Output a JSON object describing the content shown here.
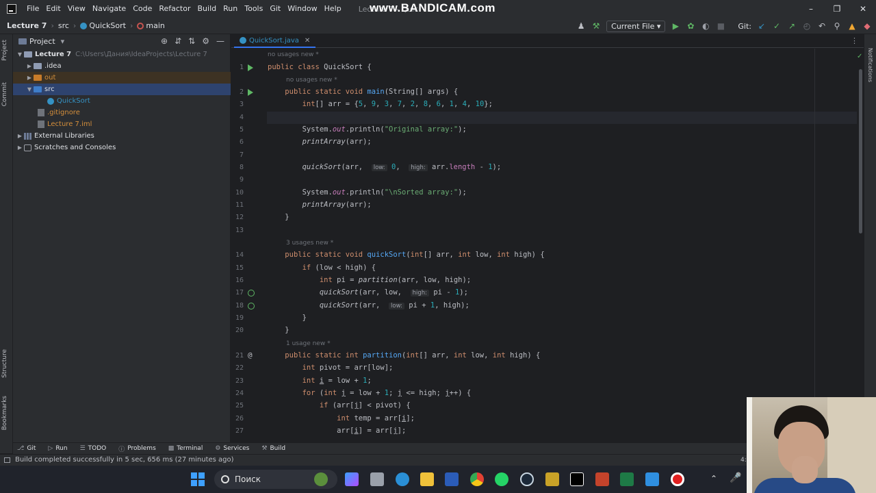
{
  "titlebar": {
    "menu": [
      "File",
      "Edit",
      "View",
      "Navigate",
      "Code",
      "Refactor",
      "Build",
      "Run",
      "Tools",
      "Git",
      "Window",
      "Help"
    ],
    "window_title": "Lecture 7 - Quic",
    "watermark": "www.BANDICAM.com"
  },
  "navbar": {
    "project": "Lecture 7",
    "folder": "src",
    "class": "QuickSort",
    "method": "main",
    "run_config": "Current File",
    "git_label": "Git:"
  },
  "project_panel": {
    "title": "Project",
    "tree": [
      {
        "label": "Lecture 7",
        "path": "C:\\Users\\Дания\\IdeaProjects\\Lecture 7"
      },
      {
        "label": ".idea"
      },
      {
        "label": "out"
      },
      {
        "label": "src"
      },
      {
        "label": "QuickSort"
      },
      {
        "label": ".gitignore"
      },
      {
        "label": "Lecture 7.iml"
      },
      {
        "label": "External Libraries"
      },
      {
        "label": "Scratches and Consoles"
      }
    ]
  },
  "editor": {
    "tab": "QuickSort.java",
    "hints": {
      "class": "no usages   new *",
      "main": "no usages   new *",
      "quicksort": "3 usages   new *",
      "partition": "1 usage   new *"
    },
    "line_numbers": [
      "1",
      "2",
      "3",
      "4",
      "5",
      "6",
      "7",
      "8",
      "9",
      "10",
      "11",
      "12",
      "13",
      "14",
      "15",
      "16",
      "17",
      "18",
      "19",
      "20",
      "21",
      "22",
      "23",
      "24",
      "25",
      "26",
      "27"
    ]
  },
  "left_stripe": {
    "project": "Project",
    "commit": "Commit",
    "structure": "Structure",
    "bookmarks": "Bookmarks"
  },
  "right_stripe": {
    "notifications": "Notifications"
  },
  "tool_windows": [
    "Git",
    "Run",
    "TODO",
    "Problems",
    "Terminal",
    "Services",
    "Build"
  ],
  "status": {
    "message": "Build completed successfully in 5 sec, 656 ms (27 minutes ago)",
    "position": "4:"
  },
  "taskbar": {
    "search_placeholder": "Поиск"
  },
  "colors": {
    "keyword": "#cf8e6d",
    "function": "#56a8f5",
    "number": "#2aacb8",
    "string": "#6aab73",
    "selection": "#2e436e",
    "accent": "#3574f0"
  }
}
